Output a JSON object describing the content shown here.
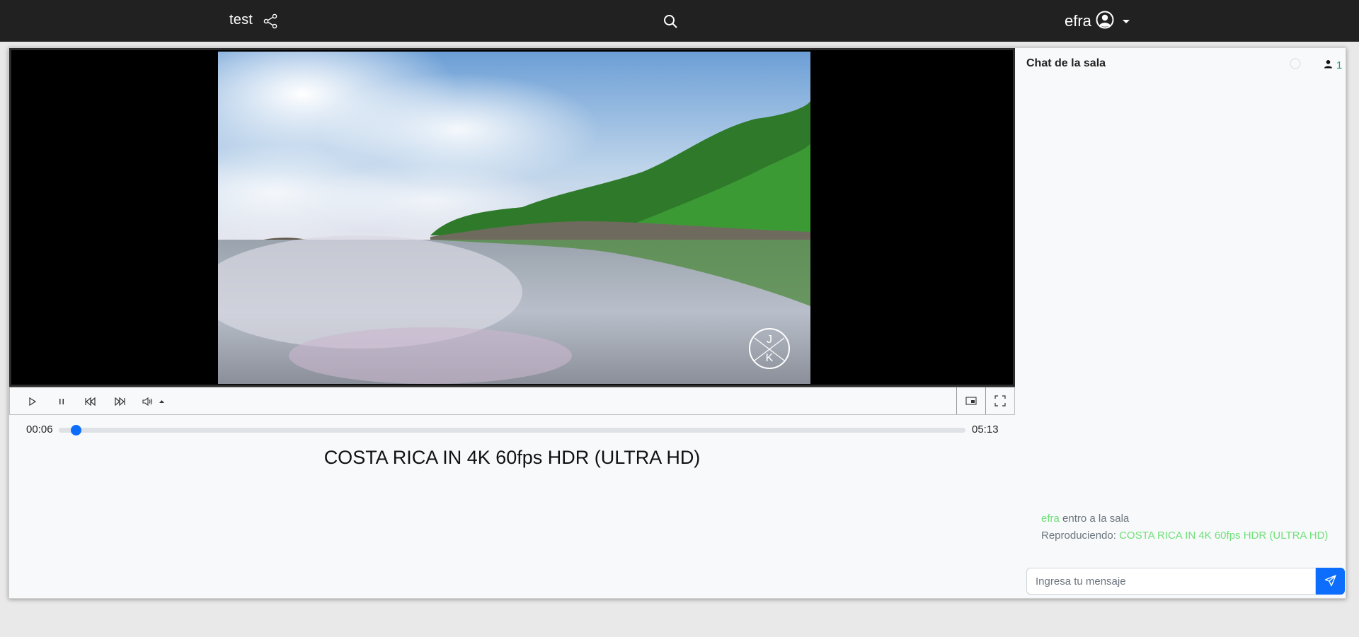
{
  "navbar": {
    "room_name": "test",
    "user_name": "efra"
  },
  "player": {
    "current_time": "00:06",
    "total_time": "05:13",
    "progress_fraction": 0.019,
    "video_title": "COSTA RICA IN 4K 60fps HDR (ULTRA HD)",
    "watermark_letters": "JK"
  },
  "chat": {
    "title": "Chat de la sala",
    "user_count": "1",
    "messages": [
      {
        "highlight": "efra",
        "text": " entro a la sala"
      },
      {
        "prefix": "Reproduciendo: ",
        "highlight": "COSTA RICA IN 4K 60fps HDR (ULTRA HD)"
      }
    ],
    "input_placeholder": "Ingresa tu mensaje"
  },
  "colors": {
    "navbar_bg": "#212121",
    "accent_blue": "#0d6efd",
    "chat_highlight": "#6fe07a",
    "user_count": "#2a9a6a"
  },
  "icons": {
    "share": "share-icon",
    "search": "search-icon",
    "user": "user-circle-icon",
    "play": "play-icon",
    "pause": "pause-icon",
    "rewind": "rewind-icon",
    "fast_forward": "fast-forward-icon",
    "volume": "volume-icon",
    "pip": "picture-in-picture-icon",
    "fullscreen": "fullscreen-icon",
    "send": "send-icon"
  }
}
